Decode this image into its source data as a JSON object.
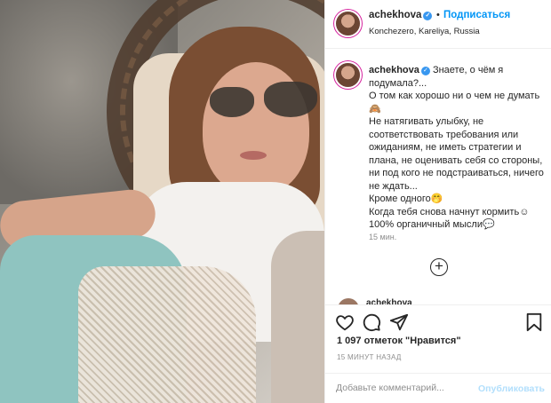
{
  "photo": {
    "alt": ""
  },
  "header": {
    "username": "achekhova",
    "separator": "•",
    "follow_label": "Подписаться",
    "location": "Konchezero, Kareliya, Russia"
  },
  "caption": {
    "username": "achekhova",
    "lines": [
      "Знаете, о чём я подумала?...",
      "О том как хорошо ни о чем не думать🙈",
      "Не натягивать улыбку, не соответствовать требования или ожиданиям, не иметь стратегии и плана, не оценивать себя со стороны, ни под кого не подстраиваться, ничего не ждать...",
      "Кроме одного🤭",
      "Когда тебя снова начнут кормить☺",
      "100% органичный мысли💬"
    ],
    "time_ago": "15 мин."
  },
  "more_comments": {
    "icon": "plus-circle-icon"
  },
  "peek_comment": {
    "username": "achekhova"
  },
  "actions": {
    "like_icon": "heart-icon",
    "comment_icon": "comment-icon",
    "share_icon": "share-icon",
    "save_icon": "bookmark-icon"
  },
  "likes": "1 097 отметок \"Нравится\"",
  "posted": "15 МИНУТ НАЗАД",
  "comment_bar": {
    "placeholder": "Добавьте комментарий...",
    "post_label": "Опубликовать"
  },
  "colors": {
    "accent": "#0095f6",
    "verified": "#3897f0",
    "muted": "#8e8e8e",
    "post_disabled": "#b2dffc"
  }
}
